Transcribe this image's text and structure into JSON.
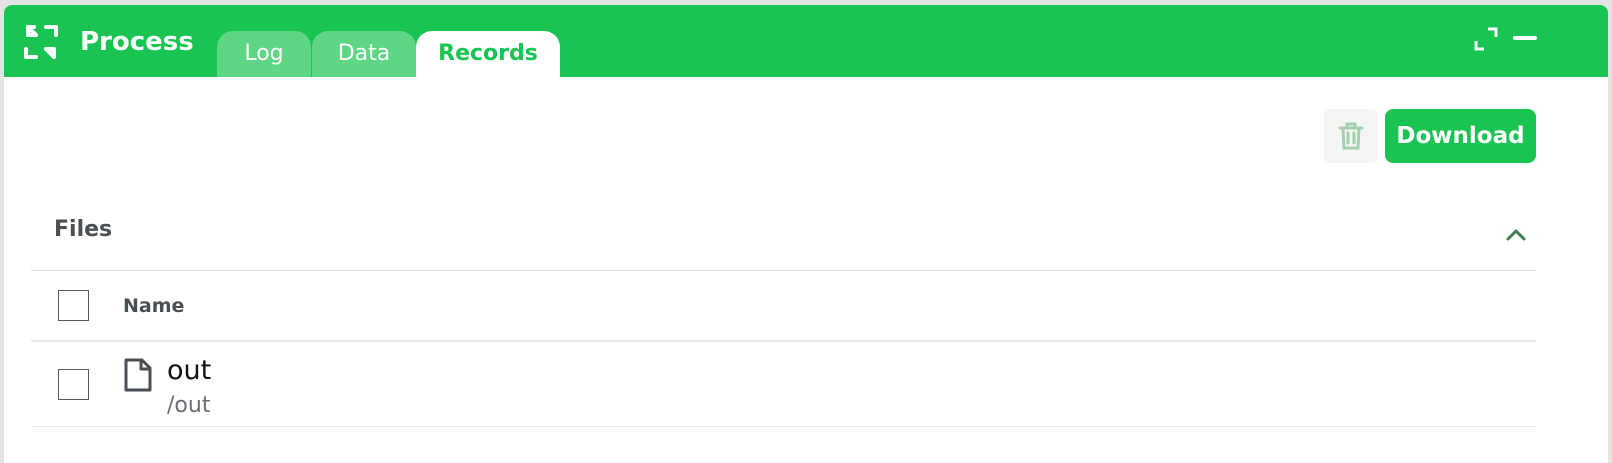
{
  "window": {
    "title": "Process",
    "tabs": [
      {
        "label": "Log",
        "active": false
      },
      {
        "label": "Data",
        "active": false
      },
      {
        "label": "Records",
        "active": true
      }
    ]
  },
  "toolbar": {
    "delete_icon": "trash-icon",
    "download_label": "Download"
  },
  "files": {
    "section_title": "Files",
    "columns": [
      "Name"
    ],
    "rows": [
      {
        "name": "out",
        "path": "/out",
        "icon": "file-icon",
        "checked": false
      }
    ]
  },
  "colors": {
    "brand": "#19c452",
    "tab_inactive": "#5fd683"
  }
}
